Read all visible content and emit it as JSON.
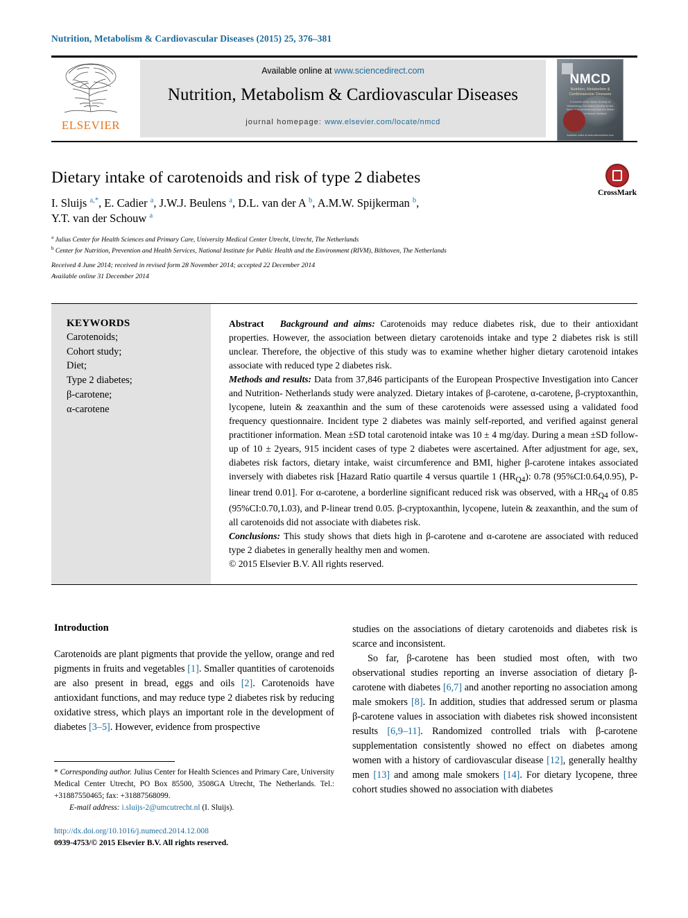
{
  "running_head": "Nutrition, Metabolism & Cardiovascular Diseases (2015) 25, 376–381",
  "masthead": {
    "elsevier_wordmark": "ELSEVIER",
    "available_online_prefix": "Available online at ",
    "available_online_link": "www.sciencedirect.com",
    "journal_name": "Nutrition, Metabolism & Cardiovascular Diseases",
    "homepage_prefix": "journal homepage: ",
    "homepage_link": "www.elsevier.com/locate/nmcd",
    "cover": {
      "acronym": "NMCD",
      "subtitle": "Nutrition, Metabolism & Cardiovascular Diseases",
      "descriptor": "A Journal of the Italian Society of Diabetology, the Italian Society for the Study of Atherosclerosis and the Italian Society of Human Nutrition",
      "footer": "Available online at www.sciencedirect.com"
    }
  },
  "article": {
    "title": "Dietary intake of carotenoids and risk of type 2 diabetes",
    "authors_line1": "I. Sluijs <sup>a,*</sup>, E. Cadier <sup>a</sup>, J.W.J. Beulens <sup>a</sup>, D.L. van der A <sup>b</sup>, A.M.W. Spijkerman <sup>b</sup>,",
    "authors_line2": "Y.T. van der Schouw <sup>a</sup>",
    "affiliation_a": "<sup>a</sup> Julius Center for Health Sciences and Primary Care, University Medical Center Utrecht, Utrecht, The Netherlands",
    "affiliation_b": "<sup>b</sup> Center for Nutrition, Prevention and Health Services, National Institute for Public Health and the Environment (RIVM), Bilthoven, The Netherlands",
    "history_received": "Received 4 June 2014; received in revised form 28 November 2014; accepted 22 December 2014",
    "history_online": "Available online 31 December 2014",
    "crossmark_label": "CrossMark"
  },
  "keywords": {
    "heading": "KEYWORDS",
    "items": [
      "Carotenoids;",
      "Cohort study;",
      "Diet;",
      "Type 2 diabetes;",
      "β-carotene;",
      "α-carotene"
    ]
  },
  "abstract": {
    "label": "Abstract",
    "background_head": "Background and aims:",
    "background_text": " Carotenoids may reduce diabetes risk, due to their antioxidant properties. However, the association between dietary carotenoids intake and type 2 diabetes risk is still unclear. Therefore, the objective of this study was to examine whether higher dietary carotenoid intakes associate with reduced type 2 diabetes risk.",
    "methods_head": "Methods and results:",
    "methods_text": " Data from 37,846 participants of the European Prospective Investigation into Cancer and Nutrition- Netherlands study were analyzed. Dietary intakes of β-carotene, α-carotene, β-cryptoxanthin, lycopene, lutein & zeaxanthin and the sum of these carotenoids were assessed using a validated food frequency questionnaire. Incident type 2 diabetes was mainly self-reported, and verified against general practitioner information. Mean ±SD total carotenoid intake was 10 ± 4 mg/day. During a mean ±SD follow-up of 10 ± 2years, 915 incident cases of type 2 diabetes were ascertained. After adjustment for age, sex, diabetes risk factors, dietary intake, waist circumference and BMI, higher β-carotene intakes associated inversely with diabetes risk [Hazard Ratio quartile 4 versus quartile 1 (HR",
    "methods_sub1": "Q4",
    "methods_text2": "): 0.78 (95%CI:0.64,0.95), P-linear trend 0.01]. For α-carotene, a borderline significant reduced risk was observed, with a HR",
    "methods_sub2": "Q4",
    "methods_text3": " of 0.85 (95%CI:0.70,1.03), and P-linear trend 0.05. β-cryptoxanthin, lycopene, lutein & zeaxanthin, and the sum of all carotenoids did not associate with diabetes risk.",
    "conclusions_head": "Conclusions:",
    "conclusions_text": " This study shows that diets high in β-carotene and α-carotene are associated with reduced type 2 diabetes in generally healthy men and women.",
    "copyright": "© 2015 Elsevier B.V. All rights reserved."
  },
  "body": {
    "intro_heading": "Introduction",
    "left_paragraph": "Carotenoids are plant pigments that provide the yellow, orange and red pigments in fruits and vegetables <span class=\"ref\">[1]</span>. Smaller quantities of carotenoids are also present in bread, eggs and oils <span class=\"ref\">[2]</span>. Carotenoids have antioxidant functions, and may reduce type 2 diabetes risk by reducing oxidative stress, which plays an important role in the development of diabetes <span class=\"ref\">[3–5]</span>. However, evidence from prospective",
    "right_paragraph_1": "studies on the associations of dietary carotenoids and diabetes risk is scarce and inconsistent.",
    "right_paragraph_2": "So far, β-carotene has been studied most often, with two observational studies reporting an inverse association of dietary β-carotene with diabetes <span class=\"ref\">[6,7]</span> and another reporting no association among male smokers <span class=\"ref\">[8]</span>. In addition, studies that addressed serum or plasma β-carotene values in association with diabetes risk showed inconsistent results <span class=\"ref\">[6,9–11]</span>. Randomized controlled trials with β-carotene supplementation consistently showed no effect on diabetes among women with a history of cardiovascular disease <span class=\"ref\">[12]</span>, generally healthy men <span class=\"ref\">[13]</span> and among male smokers <span class=\"ref\">[14]</span>. For dietary lycopene, three cohort studies showed no association with diabetes"
  },
  "footnote": {
    "corresponding": "* <span class=\"it\">Corresponding author.</span> Julius Center for Health Sciences and Primary Care, University Medical Center Utrecht, PO Box 85500, 3508GA Utrecht, The Netherlands. Tel.: +31887550465; fax: +31887568099.",
    "email_label": "E-mail address:",
    "email": "i.sluijs-2@umcutrecht.nl",
    "email_owner": "(I. Sluijs)."
  },
  "doi": {
    "url": "http://dx.doi.org/10.1016/j.numecd.2014.12.008",
    "copyright": "0939-4753/© 2015 Elsevier B.V. All rights reserved."
  },
  "colors": {
    "link_blue": "#1b6a9c",
    "elsevier_orange": "#e8741c",
    "crossmark_red": "#b4272b",
    "panel_grey": "#e2e2e2"
  }
}
